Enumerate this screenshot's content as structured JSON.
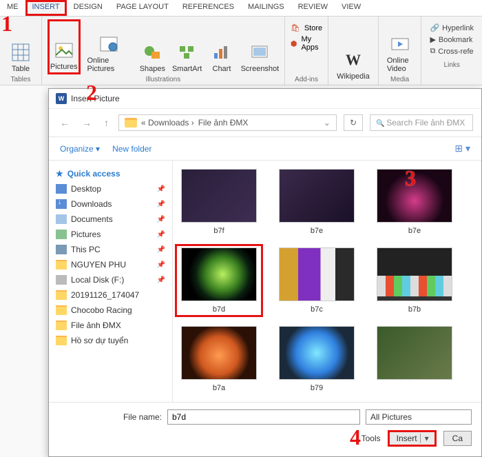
{
  "tabs": {
    "home": "ME",
    "insert": "INSERT",
    "design": "DESIGN",
    "pagelayout": "PAGE LAYOUT",
    "references": "REFERENCES",
    "mailings": "MAILINGS",
    "review": "REVIEW",
    "view": "VIEW"
  },
  "ribbon": {
    "table": "Table",
    "pictures": "Pictures",
    "online_pictures": "Online Pictures",
    "shapes": "Shapes",
    "smartart": "SmartArt",
    "chart": "Chart",
    "screenshot": "Screenshot",
    "store": "Store",
    "myapps": "My Apps",
    "wikipedia": "Wikipedia",
    "online_video": "Online Video",
    "hyperlink": "Hyperlink",
    "bookmark": "Bookmark",
    "crossref": "Cross-refe",
    "g_tables": "Tables",
    "g_illustrations": "Illustrations",
    "g_addins": "Add-ins",
    "g_media": "Media",
    "g_links": "Links"
  },
  "dialog": {
    "title": "Insert Picture",
    "crumb_prefix": "«  Downloads  ›",
    "crumb_folder": "File ảnh ĐMX",
    "search_placeholder": "Search File ảnh ĐMX",
    "organize": "Organize ▾",
    "newfolder": "New folder",
    "sidebar": {
      "quick": "Quick access",
      "desktop": "Desktop",
      "downloads": "Downloads",
      "documents": "Documents",
      "pictures": "Pictures",
      "thispc": "This PC",
      "nguyen": "NGUYEN PHU",
      "local": "Local Disk (F:)",
      "date": "20191126_174047",
      "chocobo": "Chocobo Racing",
      "fileanh": "File ảnh ĐMX",
      "hoso": "Hồ sơ dự tuyển"
    },
    "files": {
      "b7f": "b7f",
      "b7e": "b7e",
      "b7e2": "b7e",
      "b7d": "b7d",
      "b7c": "b7c",
      "b7b": "b7b",
      "b7a": "b7a",
      "b79": "b79"
    },
    "footer": {
      "filename_label": "File name:",
      "filename_value": "b7d",
      "filter": "All Pictures",
      "tools": "Tools",
      "insert": "Insert",
      "cancel": "Ca"
    }
  },
  "callouts": {
    "c1": "1",
    "c2": "2",
    "c3": "3",
    "c4": "4"
  }
}
